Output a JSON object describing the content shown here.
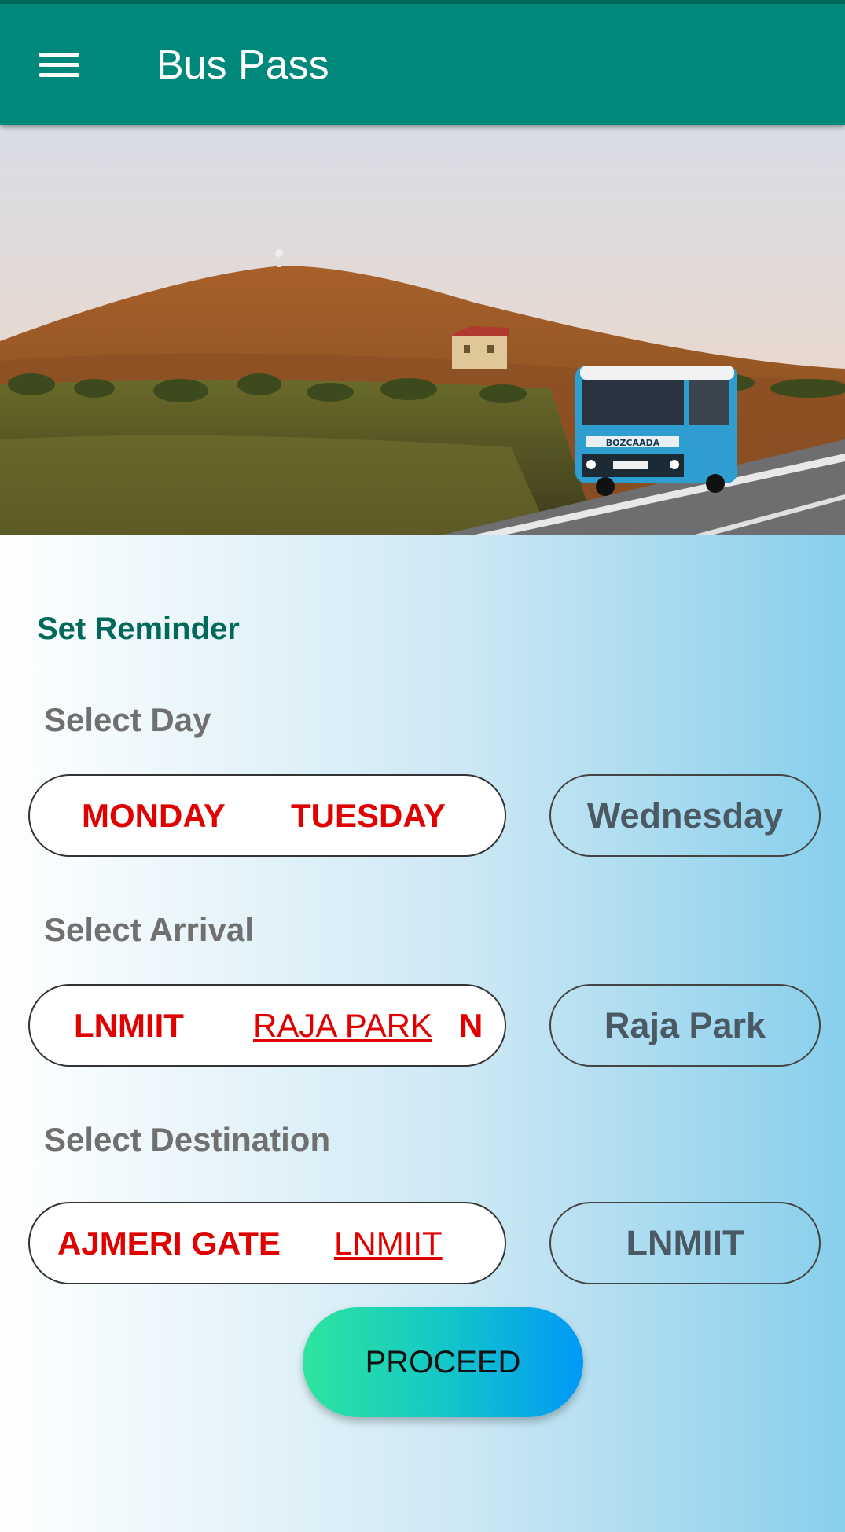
{
  "appbar": {
    "title": "Bus Pass",
    "menu_icon": "hamburger-menu-icon",
    "color": "#00897b"
  },
  "hero": {
    "image": "photo of a blue bus on a road beside a hill at sunset",
    "bus_sign": "BOZCAADA"
  },
  "form": {
    "title": "Set Reminder",
    "day": {
      "label": "Select Day",
      "options": [
        "MONDAY",
        "TUESDAY"
      ],
      "selected": "Wednesday"
    },
    "arrival": {
      "label": "Select Arrival",
      "options": [
        "LNMIIT",
        "RAJA PARK",
        "N"
      ],
      "selected": "Raja Park"
    },
    "destination": {
      "label": "Select Destination",
      "options": [
        "AJMERI GATE",
        "LNMIIT"
      ],
      "selected": "LNMIIT"
    },
    "proceed_label": "PROCEED"
  },
  "colors": {
    "option_text": "#e00000",
    "title": "#00695c",
    "label": "#707070"
  }
}
